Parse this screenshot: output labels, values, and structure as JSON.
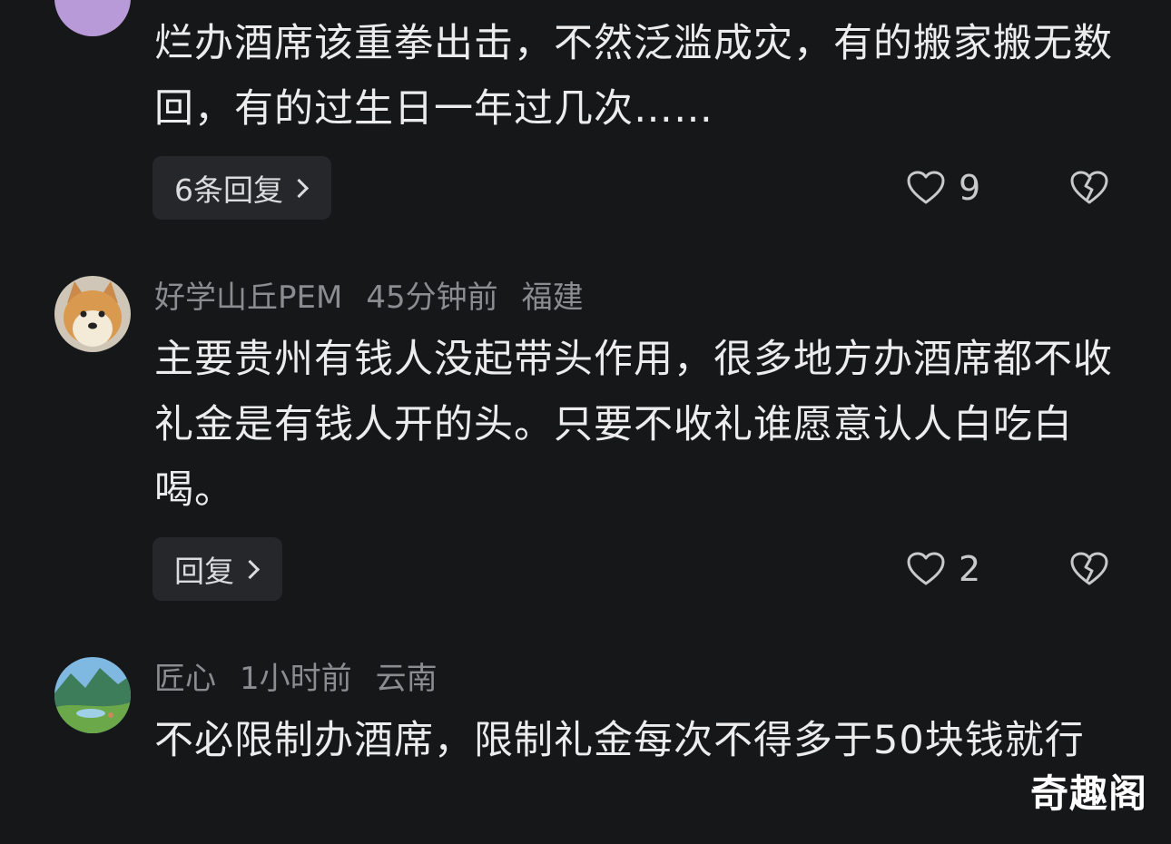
{
  "comments": [
    {
      "text": "烂办酒席该重拳出击，不然泛滥成灾，有的搬家搬无数回，有的过生日一年过几次……",
      "reply_label": "6条回复",
      "likes": "9"
    },
    {
      "username": "好学山丘PEM",
      "time": "45分钟前",
      "location": "福建",
      "text": "主要贵州有钱人没起带头作用，很多地方办酒席都不收礼金是有钱人开的头。只要不收礼谁愿意认人白吃白喝。",
      "reply_label": "回复",
      "likes": "2"
    },
    {
      "username": "匠心",
      "time": "1小时前",
      "location": "云南",
      "text": "不必限制办酒席，限制礼金每次不得多于50块钱就行"
    }
  ],
  "watermark": "奇趣阁",
  "colors": {
    "background": "#161719",
    "text": "#ececed",
    "meta": "#8b8c90",
    "button_bg": "#25272a"
  }
}
